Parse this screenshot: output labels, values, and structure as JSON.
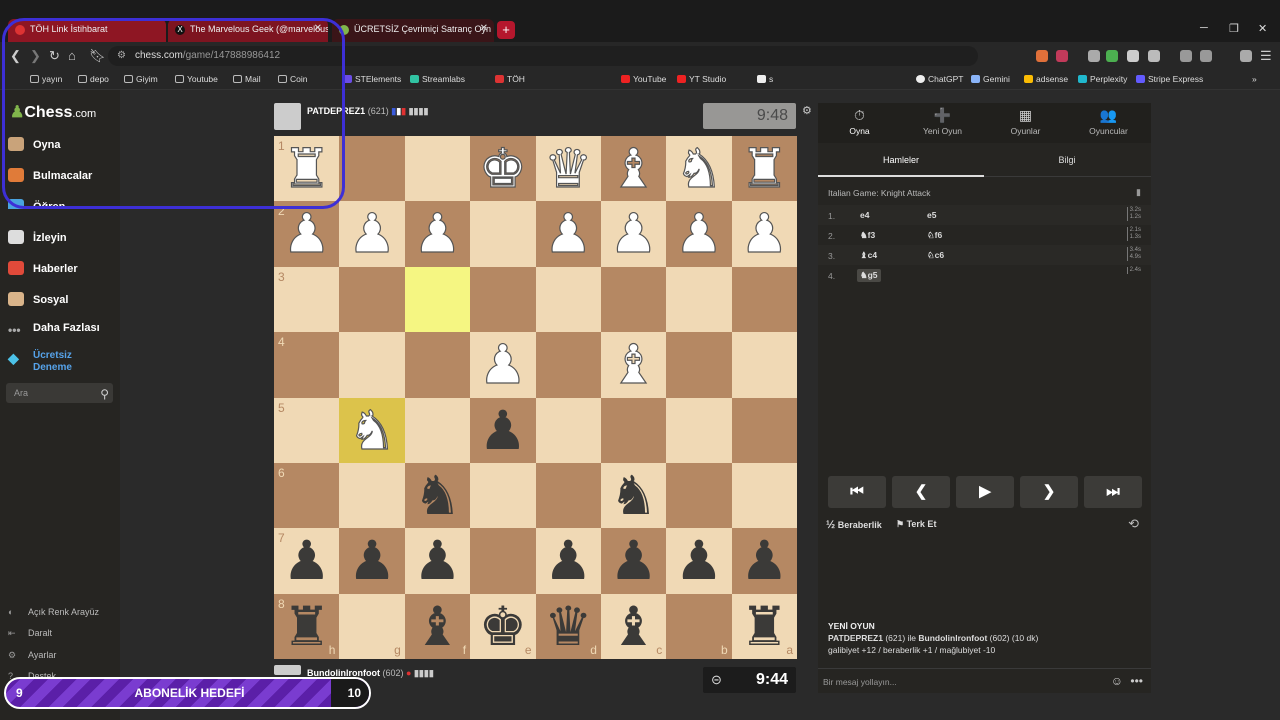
{
  "browser": {
    "tabs": [
      {
        "title": "TÖH Link İstihbarat",
        "fav_color": "#d33"
      },
      {
        "title": "The Marvelous Geek (@marvelousge",
        "fav_color": "#111"
      },
      {
        "title": "ÜCRETSİZ Çevrimiçi Satranç Oyn",
        "fav_color": "#81b64c"
      }
    ],
    "new_tab": "+",
    "url_host": "chess.com",
    "url_path": "/game/147888986412",
    "bookmarks": [
      "yayın",
      "depo",
      "Giyim",
      "Youtube",
      "Mail",
      "Coin",
      "STElements",
      "Streamlabs",
      "TÖH",
      "YouTube",
      "YT Studio",
      "s",
      "ChatGPT",
      "Gemini",
      "adsense",
      "Perplexity",
      "Stripe Express"
    ]
  },
  "sidebar": {
    "logo_main": "Chess",
    "logo_suffix": ".com",
    "items": [
      {
        "label": "Oyna",
        "color": "#c9a37a"
      },
      {
        "label": "Bulmacalar",
        "color": "#e07b39"
      },
      {
        "label": "Öğren",
        "color": "#4aa3df"
      },
      {
        "label": "İzleyin",
        "color": "#ddd"
      },
      {
        "label": "Haberler",
        "color": "#e04a3a"
      },
      {
        "label": "Sosyal",
        "color": "#d9b48a"
      },
      {
        "label": "Daha Fazlası",
        "color": "#999"
      }
    ],
    "trial_line1": "Ücretsiz",
    "trial_line2": "Deneme",
    "search_placeholder": "Ara",
    "footer": [
      "Açık Renk Arayüz",
      "Daralt",
      "Ayarlar",
      "Destek"
    ]
  },
  "game": {
    "top_player": {
      "name": "PATDEPREZ1",
      "rating": "(621)",
      "clock": "9:48"
    },
    "bottom_player": {
      "name": "Bundolinlronfoot",
      "rating": "(602)",
      "clock": "9:44"
    },
    "ranks": [
      "1",
      "2",
      "3",
      "4",
      "5",
      "6",
      "7",
      "8"
    ],
    "files": [
      "h",
      "g",
      "f",
      "e",
      "d",
      "c",
      "b",
      "a"
    ],
    "board": [
      [
        "wR",
        "",
        "",
        "wK",
        "wQ",
        "wB",
        "wN",
        "wR"
      ],
      [
        "wP",
        "wP",
        "wP",
        "",
        "wP",
        "wP",
        "wP",
        "wP"
      ],
      [
        "",
        "",
        "",
        "",
        "",
        "",
        "",
        ""
      ],
      [
        "",
        "",
        "",
        "wP",
        "",
        "wB",
        "",
        ""
      ],
      [
        "",
        "wN",
        "",
        "bP",
        "",
        "",
        "",
        ""
      ],
      [
        "",
        "",
        "bN",
        "",
        "",
        "bN",
        "",
        ""
      ],
      [
        "bP",
        "bP",
        "bP",
        "",
        "bP",
        "bP",
        "bP",
        "bP"
      ],
      [
        "bR",
        "",
        "bB",
        "bK",
        "bQ",
        "bB",
        "",
        "bR"
      ]
    ],
    "highlights": [
      [
        2,
        2
      ],
      [
        4,
        1
      ]
    ],
    "colors": {
      "light": "#f0d9b5",
      "dark": "#b58863",
      "highlight": "#f5f682",
      "highlight_dark": "#dcc34b"
    }
  },
  "panel": {
    "tabs": [
      {
        "label": "Oyna",
        "icon": "⏱"
      },
      {
        "label": "Yeni Oyun",
        "icon": "➕"
      },
      {
        "label": "Oyunlar",
        "icon": "▦"
      },
      {
        "label": "Oyuncular",
        "icon": "👥"
      }
    ],
    "subtabs": [
      "Hamleler",
      "Bilgi"
    ],
    "opening": "Italian Game: Knight Attack",
    "moves": [
      {
        "num": "1.",
        "white": "e4",
        "black": "e5",
        "t1": "3.2s",
        "t2": "1.2s"
      },
      {
        "num": "2.",
        "white": "♞f3",
        "black": "♘f6",
        "t1": "2.1s",
        "t2": "1.3s"
      },
      {
        "num": "3.",
        "white": "♝c4",
        "black": "♘c6",
        "t1": "3.4s",
        "t2": "4.9s"
      },
      {
        "num": "4.",
        "white": "♞g5",
        "black": "",
        "t1": "2.4s",
        "t2": ""
      }
    ],
    "controls": [
      "⏮",
      "❮",
      "▶",
      "❯",
      "⏭"
    ],
    "draw_label": "Beraberlik",
    "resign_label": "Terk Et",
    "new_game_title": "YENİ OYUN",
    "new_game_line1_a": "PATDEPREZ1",
    "new_game_line1_b": " (621) ile ",
    "new_game_line1_c": "Bundolinlronfoot",
    "new_game_line1_d": " (602) (10 dk)",
    "new_game_line2": "galibiyet +12 / beraberlik +1 / mağlubiyet -10",
    "chat_placeholder": "Bir mesaj yollayın..."
  },
  "overlay": {
    "current": "9",
    "label": "ABONELİK HEDEFİ",
    "goal": "10"
  }
}
